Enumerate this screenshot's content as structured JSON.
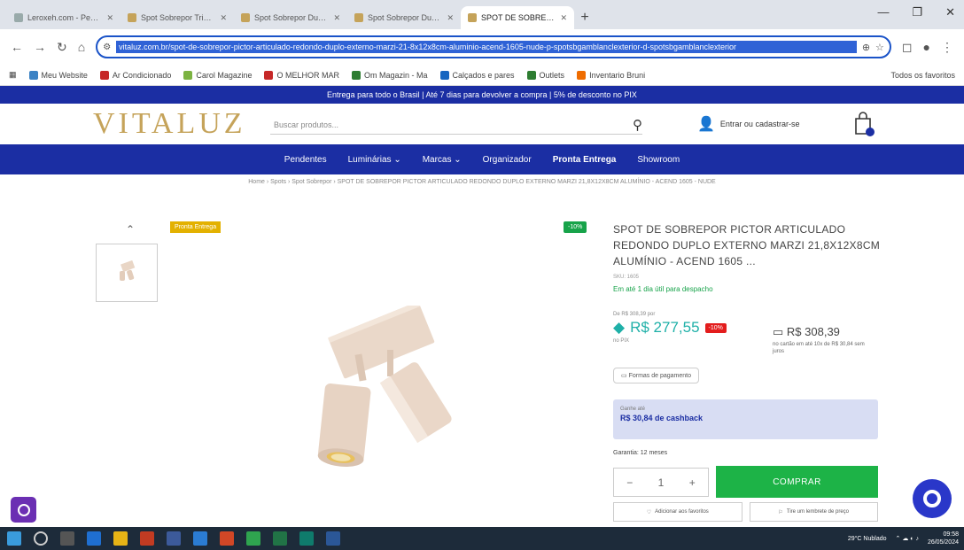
{
  "browser": {
    "tabs": [
      {
        "label": "Leroxeh.com - Pesquisa Goo"
      },
      {
        "label": "Spot Sobrepor Tribo Alumini"
      },
      {
        "label": "Spot Sobrepor Duplo Alumini"
      },
      {
        "label": "Spot Sobrepor Duplo Alumini"
      },
      {
        "label": "SPOT DE SOBREPOR PICTOR A",
        "active": true
      }
    ],
    "url": "vitaluz.com.br/spot-de-sobrepor-pictor-articulado-redondo-duplo-externo-marzi-21-8x12x8cm-aluminio-acend-1605-nude-p-spotsbgamblanclexterior-d-spotsbgamblanclexterior",
    "bookmarks": [
      {
        "label": "Meu Website",
        "color": "#3b82c4"
      },
      {
        "label": "Ar Condicionado",
        "color": "#c62828"
      },
      {
        "label": "Carol Magazine",
        "color": "#7cb342"
      },
      {
        "label": "O MELHOR MAR",
        "color": "#c62828"
      },
      {
        "label": "Om Magazin - Ma",
        "color": "#2e7d32"
      },
      {
        "label": "Calçados e pares",
        "color": "#1565c0"
      },
      {
        "label": "Outlets",
        "color": "#2e7d32"
      },
      {
        "label": "Inventario Bruni",
        "color": "#ef6c00"
      }
    ],
    "bookmarks_right": "Todos os favoritos"
  },
  "site": {
    "promo_bar": "Entrega para todo o Brasil | Até 7 dias para devolver a compra | 5% de desconto no PIX",
    "logo": "VITALUZ",
    "search_placeholder": "Buscar produtos...",
    "account_label": "Entrar ou cadastrar-se",
    "nav": [
      "Pendentes",
      "Luminárias ⌄",
      "Marcas ⌄",
      "Organizador",
      "Pronta Entrega",
      "Showroom"
    ],
    "breadcrumb": "Home › Spots › Spot Sobrepor › SPOT DE SOBREPOR PICTOR ARTICULADO REDONDO DUPLO EXTERNO MARZI 21,8X12X8CM ALUMÍNIO - ACEND 1605 - NUDE",
    "badge_ready": "Pronta Entrega",
    "badge_off": "-10%"
  },
  "product": {
    "title": "SPOT DE SOBREPOR PICTOR ARTICULADO REDONDO DUPLO EXTERNO MARZI 21,8X12X8CM ALUMÍNIO - ACEND 1605 ...",
    "sku": "SKU: 1605",
    "stock": "Em até 1 dia útil para despacho",
    "old_price": "De R$ 308,39 por",
    "pix_price": "R$ 277,55",
    "pix_off": "-10%",
    "pix_label": "no PIX",
    "card_price": "R$ 308,39",
    "installment": "no cartão em até 10x de R$ 30,84 sem juros",
    "payment_forms": "Formas de pagamento",
    "cashback_top": "Ganhe até",
    "cashback": "R$ 30,84 de cashback",
    "guarantee": "Garantia: 12 meses",
    "qty": "1",
    "buy": "COMPRAR",
    "favorite": "Adicionar aos favoritos",
    "share": "Tire um lembrete de preço"
  },
  "taskbar": {
    "weather": "29°C Nublado",
    "time": "09:58",
    "date": "26/05/2024"
  }
}
